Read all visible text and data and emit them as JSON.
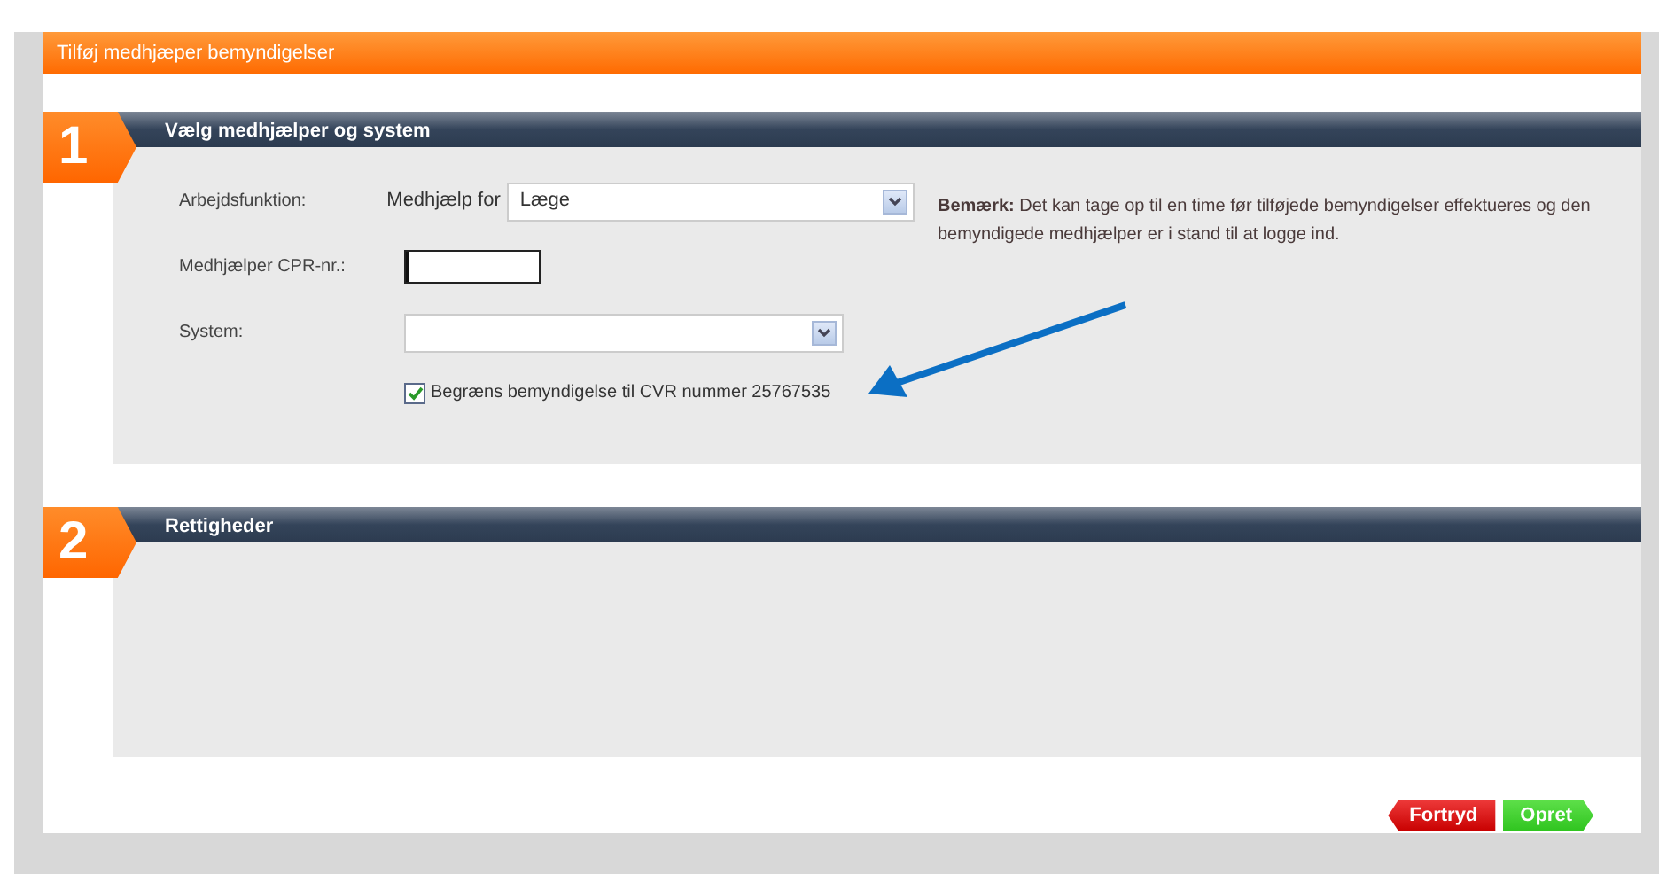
{
  "dialog": {
    "title": "Tilføj medhjæper bemyndigelser"
  },
  "sections": [
    {
      "number": "1",
      "title": "Vælg medhjælper og system",
      "kind": "form"
    },
    {
      "number": "2",
      "title": "Rettigheder",
      "kind": "empty"
    }
  ],
  "fields": [
    {
      "kind": "select",
      "label": "Arbejdsfunktion:",
      "prefix": "Medhjælp for",
      "value": "Læge"
    },
    {
      "kind": "text",
      "label": "Medhjælper CPR-nr.:"
    },
    {
      "kind": "select",
      "label": "System:"
    }
  ],
  "limit_checkbox": {
    "label": "Begræns bemyndigelse til CVR nummer 25767535",
    "checked": true
  },
  "note": "**Bemærk:** Det kan tage op til en time før tilføjede bemyndigelser effektueres og den bemyndigede medhjælper er i stand til at logge ind.",
  "buttons": [
    {
      "label": "Fortryd",
      "kind": "cancel"
    },
    {
      "label": "Opret",
      "kind": "confirm"
    }
  ]
}
